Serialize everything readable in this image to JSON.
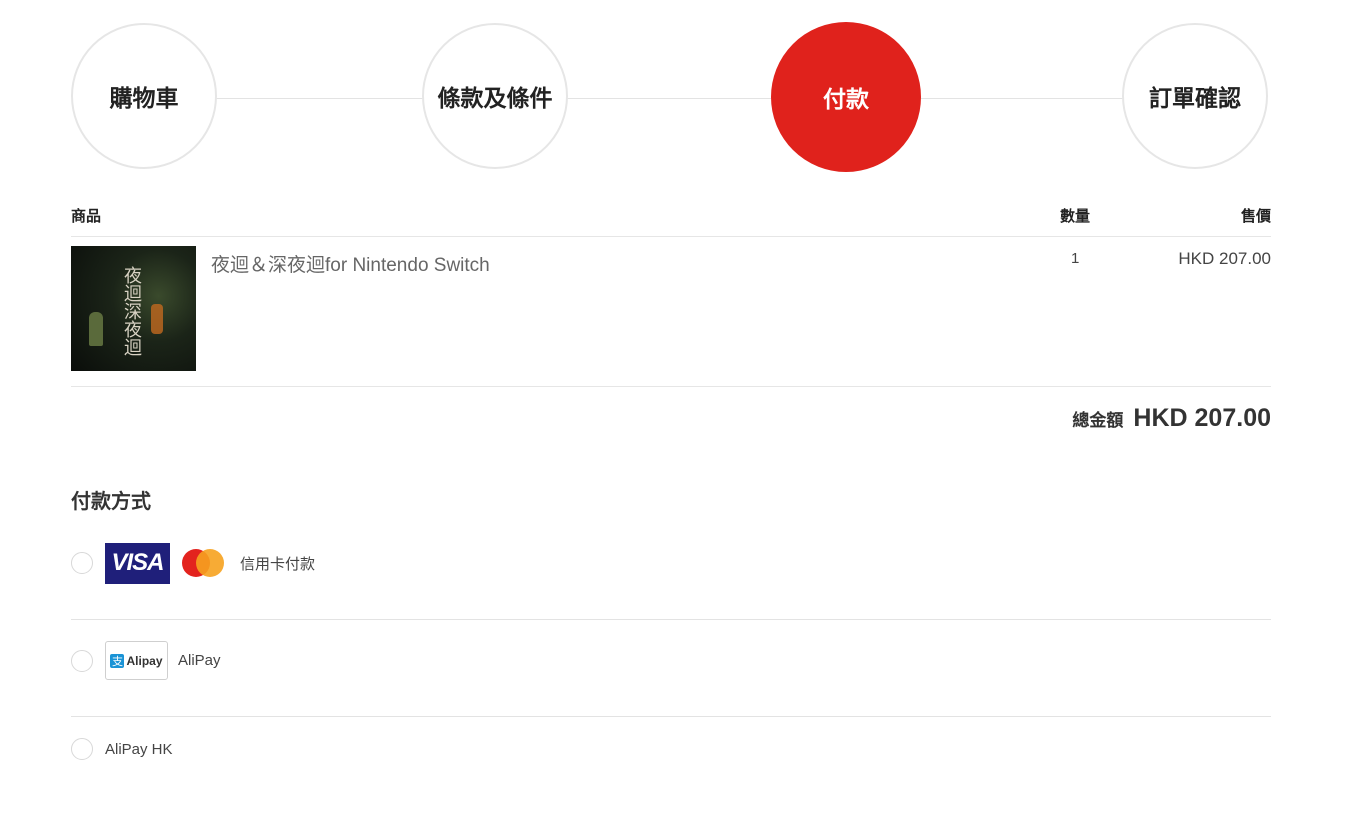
{
  "steps": [
    {
      "label": "購物車",
      "active": false
    },
    {
      "label": "條款及條件",
      "active": false
    },
    {
      "label": "付款",
      "active": true
    },
    {
      "label": "訂單確認",
      "active": false
    }
  ],
  "cart": {
    "headers": {
      "product": "商品",
      "quantity": "數量",
      "price": "售價"
    },
    "items": [
      {
        "name": "夜迴＆深夜迴for Nintendo Switch",
        "quantity": "1",
        "price": "HKD 207.00",
        "thumb_text": "夜迴深夜迴"
      }
    ]
  },
  "total": {
    "label": "總金額",
    "value": "HKD 207.00"
  },
  "payment": {
    "title": "付款方式",
    "options": [
      {
        "label": "信用卡付款",
        "logos": [
          "VISA",
          "mastercard"
        ],
        "selected": false
      },
      {
        "label": "AliPay",
        "logo_text": "Alipay",
        "logo_mark": "支",
        "selected": false
      },
      {
        "label": "AliPay HK",
        "selected": false
      }
    ]
  },
  "colors": {
    "accent": "#e0221c",
    "visa_bg": "#1f1f7a",
    "alipay_blue": "#1a93d6"
  }
}
